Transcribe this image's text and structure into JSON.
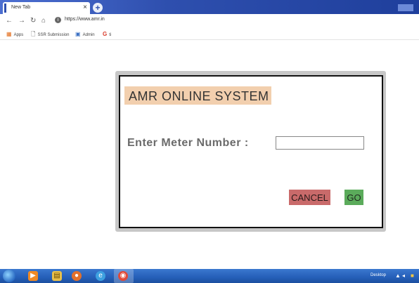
{
  "browser": {
    "tab_title": "New Tab",
    "tab_close": "×",
    "new_tab": "+",
    "url": "https://www.amr.in",
    "bookmarks": [
      {
        "icon": "apps-grid-icon",
        "glyph": "▦",
        "label": "Apps"
      },
      {
        "icon": "page-icon",
        "glyph": "🗋",
        "label": "SSR Submission"
      },
      {
        "icon": "admin-icon",
        "glyph": "▣",
        "label": "Admin"
      },
      {
        "icon": "google-icon",
        "glyph": "G",
        "label": "ti"
      }
    ]
  },
  "dialog": {
    "title": "AMR ONLINE SYSTEM",
    "meter_label": "Enter Meter Number :",
    "meter_value": "",
    "meter_placeholder": "",
    "cancel_label": "CANCEL",
    "go_label": "GO"
  },
  "taskbar": {
    "desktop_label": "Desktop"
  },
  "colors": {
    "title_background": "#f2cfae",
    "cancel_button": "#c96a6a",
    "go_button": "#5bab5b",
    "taskbar": "#255fb8"
  }
}
